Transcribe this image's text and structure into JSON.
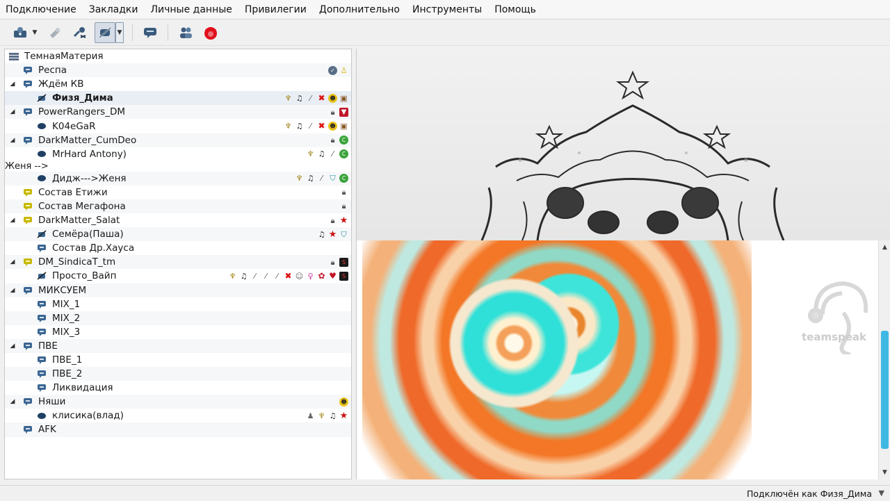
{
  "menu": [
    "Подключение",
    "Закладки",
    "Личные данные",
    "Привилегии",
    "Дополнительно",
    "Инструменты",
    "Помощь"
  ],
  "toolbar": {
    "items": [
      "connect-icon",
      "bookmark-icon",
      "disconnect-icon",
      "mute-icon",
      "chat-icon",
      "contacts-icon",
      "ts-logo-icon"
    ]
  },
  "tree": {
    "server": "ТемнаяМатерия",
    "rows": [
      {
        "name": "Респа"
      },
      {
        "name": "Ждём КВ"
      },
      {
        "name": "Физя_Дима"
      },
      {
        "name": "PowerRangers_DM"
      },
      {
        "name": "K04eGaR"
      },
      {
        "name": "DarkMatter_CumDeo"
      },
      {
        "name": "MrHard Antony)"
      },
      {
        "name": "Дидж--->Женя"
      },
      {
        "name": "Состав Етижи"
      },
      {
        "name": "Состав Мегафона"
      },
      {
        "name": "DarkMatter_Salat"
      },
      {
        "name": "Семёра(Паша)"
      },
      {
        "name": "Состав Др.Хауса"
      },
      {
        "name": "DM_SindicaT_tm"
      },
      {
        "name": "Просто_Вайп"
      },
      {
        "name": "МИКСУЕМ"
      },
      {
        "name": "MIX_1"
      },
      {
        "name": "MIX_2"
      },
      {
        "name": "MIX_3"
      },
      {
        "name": "ПВЕ"
      },
      {
        "name": "ПВЕ_1"
      },
      {
        "name": "ПВЕ_2"
      },
      {
        "name": "Ликвидация"
      },
      {
        "name": "Няши"
      },
      {
        "name": "клисика(влад)"
      },
      {
        "name": "AFK"
      }
    ]
  },
  "info": {
    "watermark": "teamspeak"
  },
  "status": {
    "connected_as": "Подключён как Физя_Дима"
  },
  "colors": {
    "accent": "#3fb8e4",
    "channel": "#3a6591",
    "client": "#1f3f63",
    "badge_red": "#cc1111"
  }
}
